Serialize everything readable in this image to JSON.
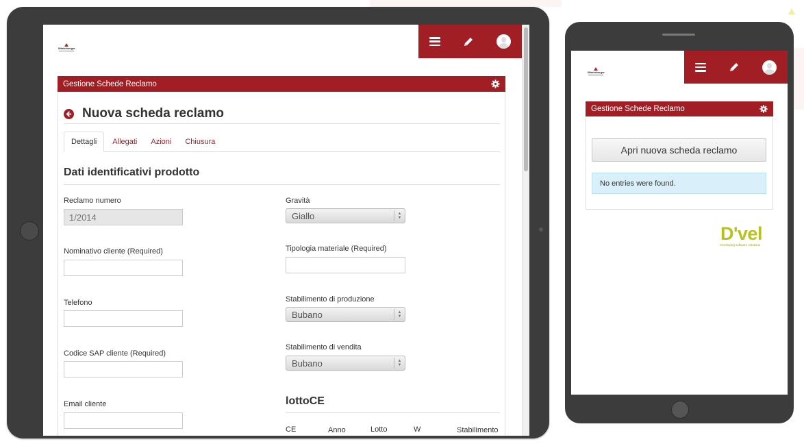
{
  "app": {
    "brand_name": "Winterberger",
    "panel_title": "Gestione Schede Reclamo",
    "icons": {
      "menu": "hamburger-icon",
      "edit": "pencil-icon",
      "user": "avatar-icon",
      "settings": "gear-icon",
      "back": "back-arrow-icon"
    },
    "accent_color": "#a01e24"
  },
  "tablet": {
    "page_title": "Nuova scheda reclamo",
    "tabs": [
      {
        "label": "Dettagli",
        "active": true
      },
      {
        "label": "Allegati",
        "active": false
      },
      {
        "label": "Azioni",
        "active": false
      },
      {
        "label": "Chiusura",
        "active": false
      }
    ],
    "section_title": "Dati identificativi prodotto",
    "left_fields": [
      {
        "label": "Reclamo numero",
        "value": "1/2014",
        "disabled": true
      },
      {
        "label": "Nominativo cliente (Required)",
        "value": ""
      },
      {
        "label": "Telefono",
        "value": ""
      },
      {
        "label": "Codice SAP cliente (Required)",
        "value": ""
      },
      {
        "label": "Email cliente",
        "value": ""
      }
    ],
    "right_fields": [
      {
        "label": "Gravità",
        "type": "select",
        "value": "Giallo"
      },
      {
        "label": "Tipologia materiale (Required)",
        "type": "input",
        "value": ""
      },
      {
        "label": "Stabilimento di produzione",
        "type": "select",
        "value": "Bubano"
      },
      {
        "label": "Stabilimento di vendita",
        "type": "select",
        "value": "Bubano"
      }
    ],
    "lotto": {
      "title": "lottoCE",
      "columns": [
        "CE",
        "Anno",
        "Lotto",
        "W",
        "Stabilimento"
      ]
    }
  },
  "phone": {
    "open_button_label": "Apri nuova scheda reclamo",
    "empty_message": "No entries were found.",
    "partner_logo": {
      "word": "D'vel",
      "tagline": "D'veloping software solutions",
      "color": "#b7c21c"
    }
  }
}
